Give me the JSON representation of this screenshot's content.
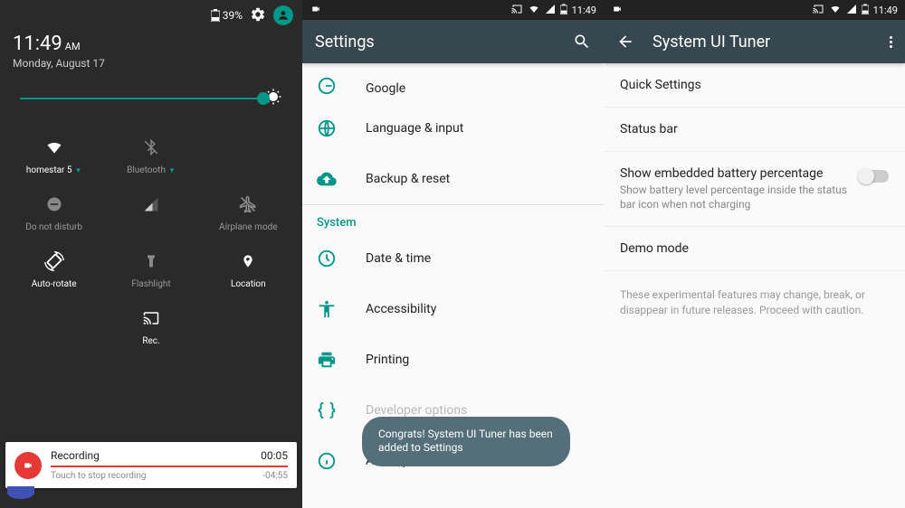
{
  "panel1": {
    "battery_pct": "39%",
    "time": "11:49",
    "ampm": "AM",
    "date": "Monday, August 17",
    "tiles": {
      "wifi": "homestar 5",
      "bluetooth": "Bluetooth",
      "dnd": "Do not disturb",
      "airplane": "Airplane mode",
      "autorotate": "Auto-rotate",
      "flashlight": "Flashlight",
      "location": "Location",
      "cast": "Rec."
    },
    "recording": {
      "title": "Recording",
      "elapsed": "00:05",
      "remaining": "-04:55",
      "hint": "Touch to stop recording"
    }
  },
  "panel2": {
    "sbar_time": "11:49",
    "title": "Settings",
    "items": {
      "google": "Google",
      "language": "Language & input",
      "backup": "Backup & reset",
      "system_header": "System",
      "datetime": "Date & time",
      "accessibility": "Accessibility",
      "printing": "Printing",
      "developer": "Developer options",
      "about": "About phone"
    },
    "toast": "Congrats! System UI Tuner has been added to Settings"
  },
  "panel3": {
    "sbar_time": "11:49",
    "title": "System UI Tuner",
    "items": {
      "quick": "Quick Settings",
      "status": "Status bar",
      "batt_title": "Show embedded battery percentage",
      "batt_sub": "Show battery level percentage inside the status bar icon when not charging",
      "demo": "Demo mode"
    },
    "footer": "These experimental features may change, break, or disappear in future releases. Proceed with caution."
  }
}
